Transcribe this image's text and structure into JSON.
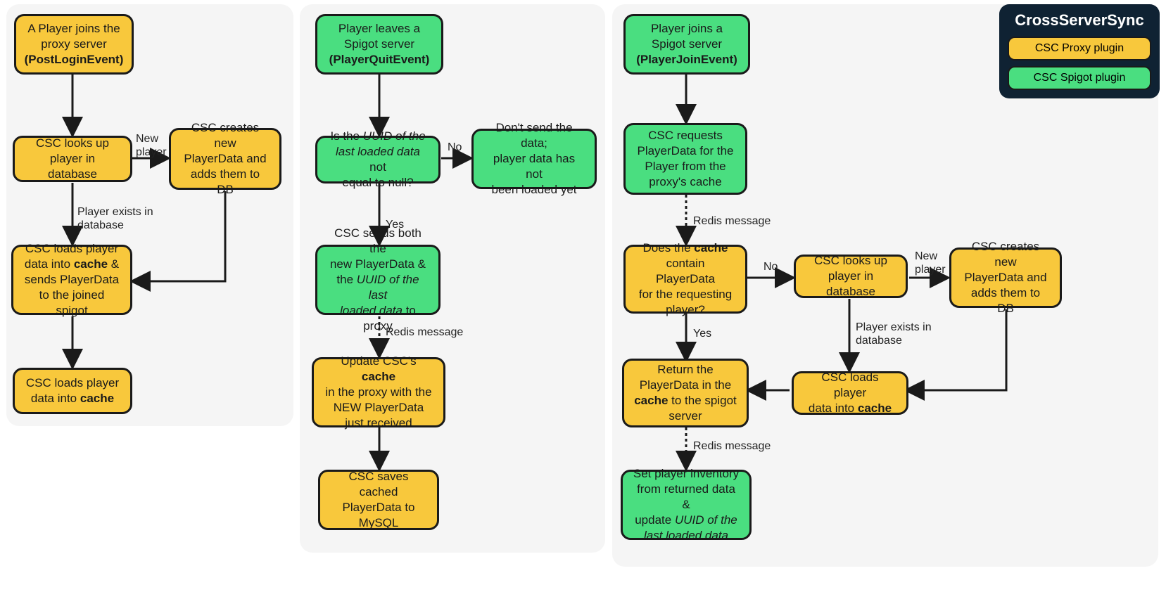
{
  "legend": {
    "title": "CrossServerSync",
    "proxy": "CSC Proxy plugin",
    "spigot": "CSC Spigot plugin"
  },
  "colors": {
    "yellow": "#f8c83c",
    "green": "#4ade80",
    "panelBg": "#f5f5f5",
    "legendBg": "#0f2233"
  },
  "flow1": {
    "n1a": "A Player joins the",
    "n1b": "proxy server",
    "n1c": "(PostLoginEvent)",
    "n2a": "CSC looks up",
    "n2b": "player in database",
    "n3a": "CSC creates new",
    "n3b": "PlayerData and",
    "n3c": "adds them to DB",
    "n4a": "CSC loads player",
    "n4b": "data into ",
    "n4c": "cache",
    "n4d": " &",
    "n4e": "sends PlayerData",
    "n4f": "to the joined spigot",
    "n5a": "CSC loads player",
    "n5b": "data into ",
    "n5c": "cache",
    "e1": "New",
    "e1b": "player",
    "e2a": "Player exists in",
    "e2b": "database"
  },
  "flow2": {
    "n1a": "Player leaves a",
    "n1b": "Spigot server",
    "n1c": "(PlayerQuitEvent)",
    "n2a": "Is the ",
    "n2b": "UUID of the",
    "n2c": "last loaded data",
    "n2d": " not",
    "n2e": "equal to null?",
    "n3a": "Don't send the data;",
    "n3b": "player data has not",
    "n3c": "been loaded yet",
    "n4a": "CSC sends both the",
    "n4b": "new PlayerData &",
    "n4c": "the ",
    "n4d": "UUID of the last",
    "n4e": "loaded data",
    "n4f": " to proxy",
    "n5a": "Update CSC's ",
    "n5b": "cache",
    "n5c": "in the proxy with the",
    "n5d": "NEW PlayerData",
    "n5e": "just received",
    "n6a": "CSC saves cached",
    "n6b": "PlayerData to",
    "n6c": "MySQL",
    "eNo": "No",
    "eYes": "Yes",
    "eRedis": "Redis message"
  },
  "flow3": {
    "n1a": "Player joins a",
    "n1b": "Spigot server",
    "n1c": "(PlayerJoinEvent)",
    "n2a": "CSC requests",
    "n2b": "PlayerData for the",
    "n2c": "Player from the",
    "n2d": "proxy's cache",
    "n3a": "Does the ",
    "n3b": "cache",
    "n3c": "contain PlayerData",
    "n3d": "for the requesting",
    "n3e": "player?",
    "n4a": "CSC looks up",
    "n4b": "player in database",
    "n5a": "CSC creates new",
    "n5b": "PlayerData and",
    "n5c": "adds them to DB",
    "n6a": "CSC loads player",
    "n6b": "data into ",
    "n6c": "cache",
    "n7a": "Return the",
    "n7b": "PlayerData in the",
    "n7c": "cache",
    "n7d": " to the spigot",
    "n7e": "server",
    "n8a": "Set player inventory",
    "n8b": "from returned data &",
    "n8c": "update ",
    "n8d": "UUID of the",
    "n8e": "last loaded data",
    "eRedis1": "Redis message",
    "eNo": "No",
    "eNew": "New",
    "eNewB": "player",
    "eExistsA": "Player exists in",
    "eExistsB": "database",
    "eYes": "Yes",
    "eRedis2": "Redis message"
  }
}
